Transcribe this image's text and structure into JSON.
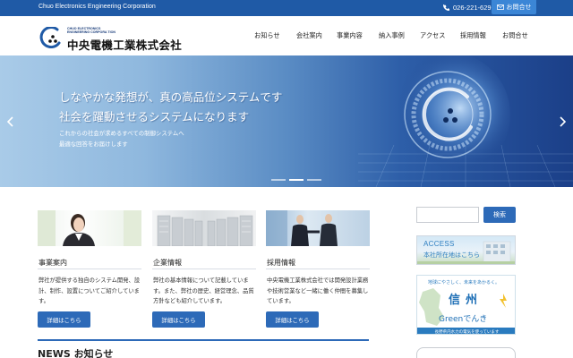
{
  "topbar": {
    "company_en": "Chuo Electronics Engineering Corporation",
    "phone": "026-221-6291",
    "contact_label": "お問合せ"
  },
  "logo": {
    "en_lines": [
      "CHUO ELECTRONICS",
      "ENGINEERING CORPORA TION"
    ],
    "jp": "中央電機工業株式会社"
  },
  "nav": [
    "お知らせ",
    "会社案内",
    "事業内容",
    "納入事例",
    "アクセス",
    "採用情報",
    "お問合せ"
  ],
  "hero": {
    "line1": "しなやかな発想が、真の高品位システムです",
    "line2": "社会を躍動させるシステムになります",
    "sub1": "これからの社会が求めるすべての制御システムへ",
    "sub2": "最適な回答をお届けします",
    "prev_icon": "chevron-left-icon",
    "next_icon": "chevron-right-icon",
    "slide_count": 3,
    "active_slide": 2
  },
  "cards": [
    {
      "title": "事業案内",
      "text": "弊社が提供する独自のシステム開発、設計、制作、設置についてご紹介しています。",
      "button": "詳細はこちら"
    },
    {
      "title": "企業情報",
      "text": "弊社の基本情報について記載しています。また、弊社の歴史、経営理念、品質方針なども紹介しています。",
      "button": "詳細はこちら"
    },
    {
      "title": "採用情報",
      "text": "中央電機工業株式会社では開発設計業務や技術営業など一緒に働く仲間を募集しています。",
      "button": "詳細はこちら"
    }
  ],
  "news": {
    "title": "NEWS お知らせ"
  },
  "sidebar": {
    "search_placeholder": "",
    "search_button": "検索",
    "access_banner": {
      "title": "ACCESS",
      "subtitle": "本社所在地はこちら"
    },
    "green_banner": {
      "tagline": "地球にやさしく、未来をあかるく。",
      "big": "信州",
      "green": "Greenでんき",
      "footer": "長野県内水力の電気を使っています"
    }
  },
  "colors": {
    "primary": "#1f5aa6",
    "button": "#2d6ab8",
    "accent_light": "#3b86d6"
  }
}
